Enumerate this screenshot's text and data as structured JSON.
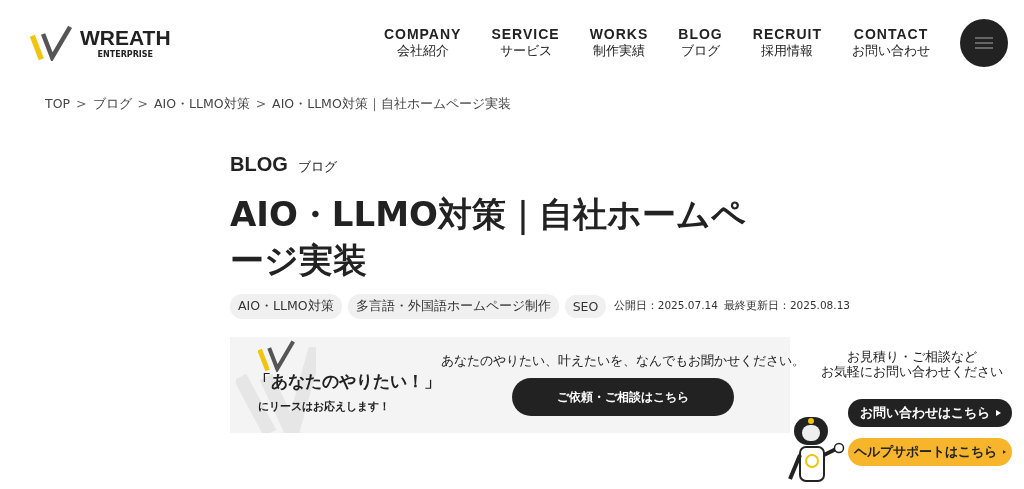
{
  "header": {
    "logo": {
      "name": "WREATH",
      "sub": "ENTERPRISE"
    },
    "nav": [
      {
        "label": "COMPANY",
        "sub": "会社紹介"
      },
      {
        "label": "SERVICE",
        "sub": "サービス"
      },
      {
        "label": "WORKS",
        "sub": "制作実績"
      },
      {
        "label": "BLOG",
        "sub": "ブログ"
      },
      {
        "label": "RECRUIT",
        "sub": "採用情報"
      },
      {
        "label": "CONTACT",
        "sub": "お問い合わせ"
      }
    ]
  },
  "breadcrumb": {
    "separator": ">",
    "items": [
      "TOP",
      "ブログ",
      "AIO・LLMO対策",
      "AIO・LLMO対策｜自社ホームページ実装"
    ]
  },
  "section": {
    "label": "BLOG",
    "sub": "ブログ"
  },
  "title": "AIO・LLMO対策｜自社ホームページ実装",
  "tags": [
    "AIO・LLMO対策",
    "多言語・外国語ホームページ制作",
    "SEO"
  ],
  "published": "公開日：2025.07.14",
  "updated": "最終更新日：2025.08.13",
  "banner": {
    "headline": "「あなたのやりたい！」",
    "subline": "にリースはお応えします！",
    "lead": "あなたのやりたい、叶えたいを、なんでもお聞かせください。",
    "button": "ご依頼・ご相談はこちら"
  },
  "widget": {
    "message": [
      "お見積り・ご相談など",
      "お気軽にお問い合わせください"
    ],
    "buttons": [
      {
        "label": "お問い合わせはこちら",
        "kind": "dark"
      },
      {
        "label": "ヘルプサポートはこちら",
        "kind": "accent"
      }
    ]
  }
}
